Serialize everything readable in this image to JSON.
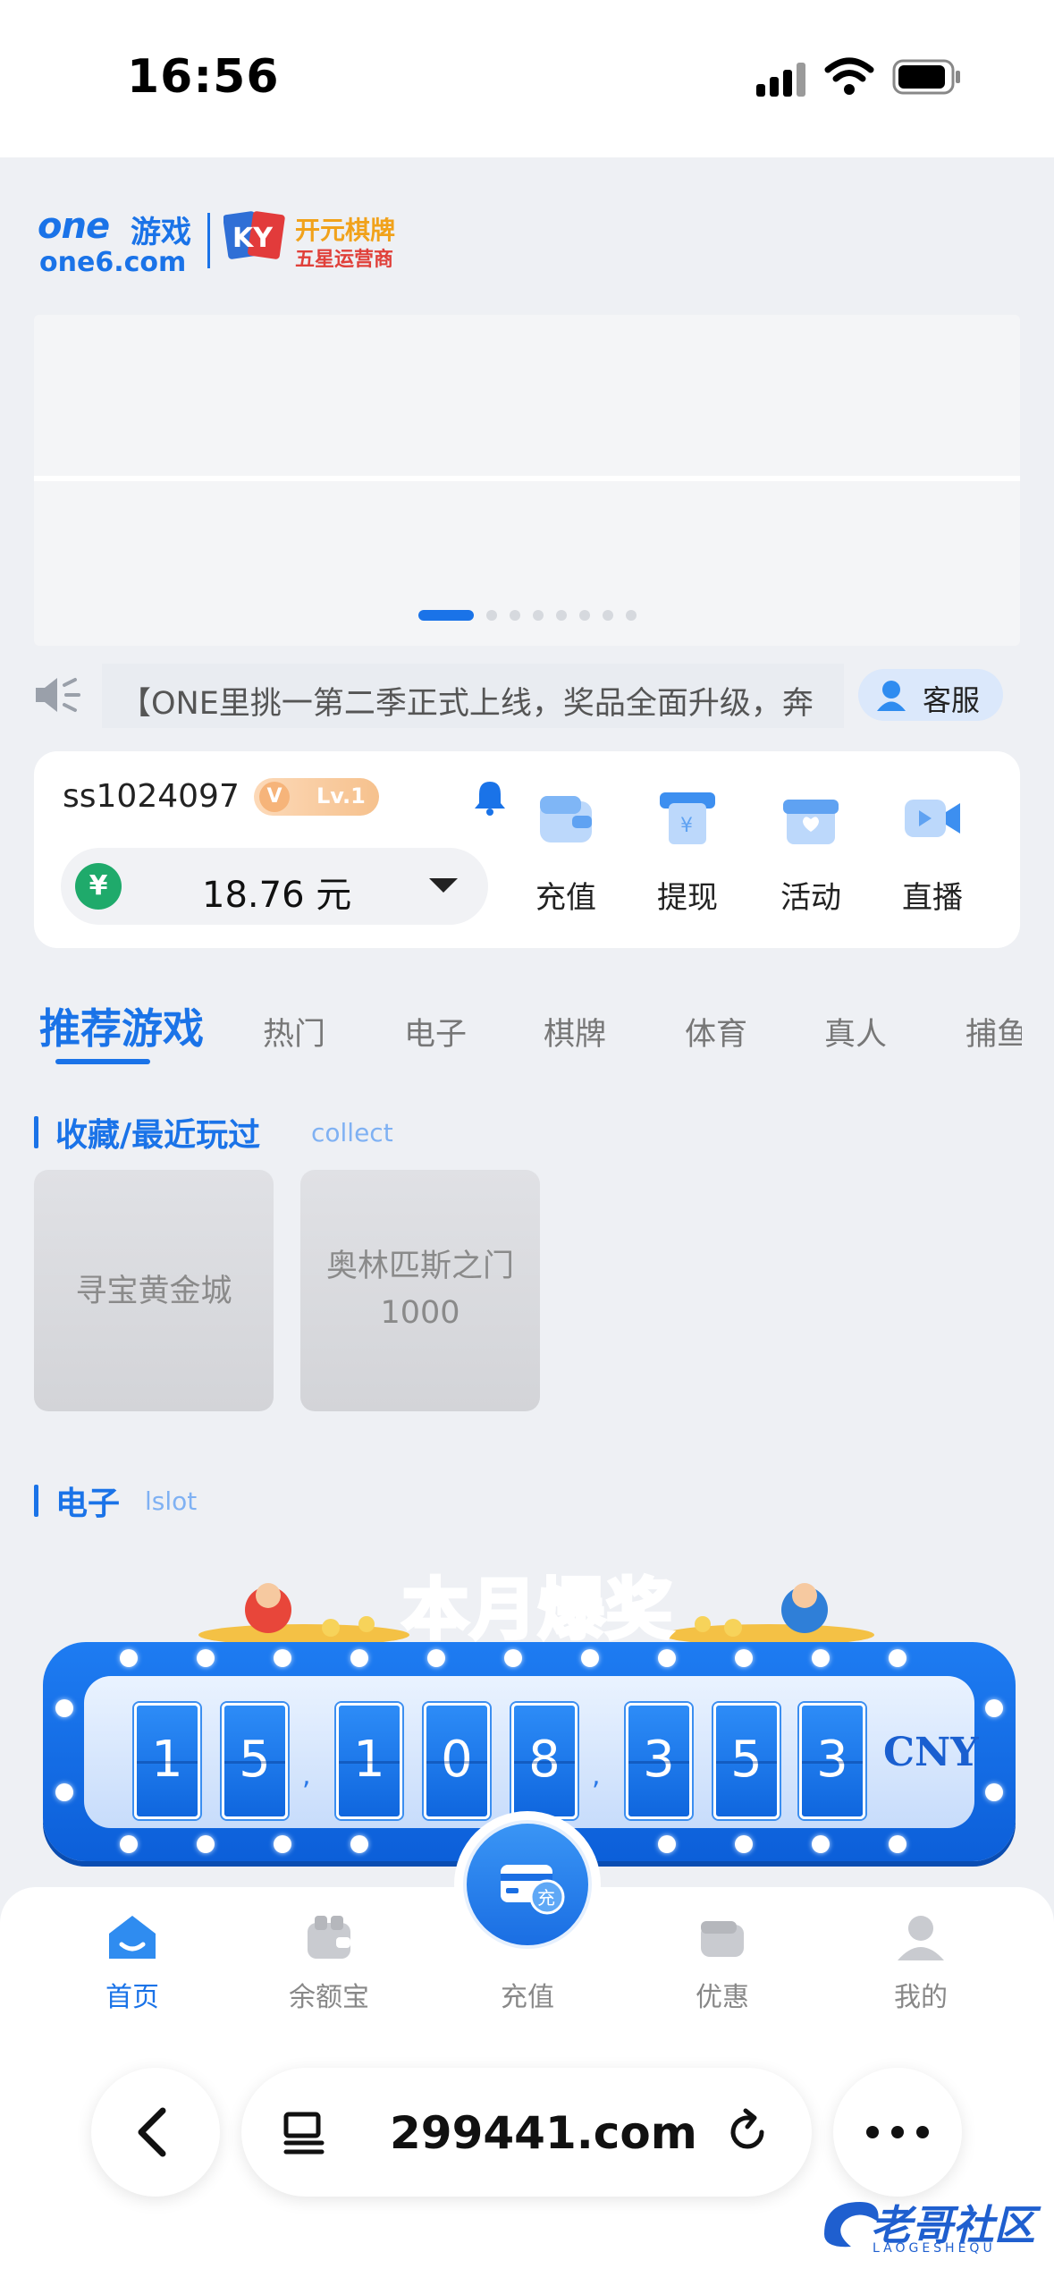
{
  "status_bar": {
    "time": "16:56"
  },
  "header": {
    "logo_one": "one",
    "logo_one_cn": "游戏",
    "logo_domain": "one6.com",
    "logo_ky": "KY",
    "logo_ky_name": "开元棋牌",
    "logo_ky_sub": "五星运营商"
  },
  "banner": {
    "slide_count": 8,
    "active_slide": 1
  },
  "notice": {
    "text": "【ONE里挑一第二季正式上线，奖品全面升级，奔",
    "service_label": "客服"
  },
  "user": {
    "username": "ss1024097",
    "vip_symbol": "V",
    "vip_level": "Lv.1",
    "currency_symbol": "¥",
    "balance": "18.76 元"
  },
  "quick_actions": [
    {
      "label": "充值",
      "icon": "wallet-icon"
    },
    {
      "label": "提现",
      "icon": "withdraw-icon"
    },
    {
      "label": "活动",
      "icon": "gift-icon"
    },
    {
      "label": "直播",
      "icon": "live-video-icon"
    }
  ],
  "tabs": [
    "推荐游戏",
    "热门",
    "电子",
    "棋牌",
    "体育",
    "真人",
    "捕鱼"
  ],
  "sections": {
    "favorites": {
      "title": "收藏/最近玩过",
      "subtitle": "collect"
    },
    "slots": {
      "title": "电子",
      "subtitle": "lslot"
    }
  },
  "favorite_games": [
    {
      "name": "寻宝黄金城"
    },
    {
      "name": "奥林匹斯之门\n1000"
    }
  ],
  "jackpot": {
    "title": "本月爆奖",
    "digits": [
      "1",
      "5",
      "1",
      "0",
      "8",
      "3",
      "5",
      "3"
    ],
    "separator": ",",
    "currency": "CNY"
  },
  "bottom_nav": {
    "items": [
      {
        "label": "首页",
        "icon": "home-icon",
        "active": true
      },
      {
        "label": "余额宝",
        "icon": "balance-treasure-icon",
        "active": false
      },
      {
        "label": "充值",
        "icon": "recharge-icon",
        "active": false
      },
      {
        "label": "优惠",
        "icon": "promo-wallet-icon",
        "active": false
      },
      {
        "label": "我的",
        "icon": "profile-icon",
        "active": false
      }
    ],
    "fab_label": "充"
  },
  "browser": {
    "url": "299441.com"
  },
  "watermark": {
    "text": "老哥社区",
    "sub": "LAOGESHEQU"
  },
  "colors": {
    "accent": "#1a73e8",
    "background": "#eef0f4",
    "balance_icon": "#1faa6b"
  }
}
